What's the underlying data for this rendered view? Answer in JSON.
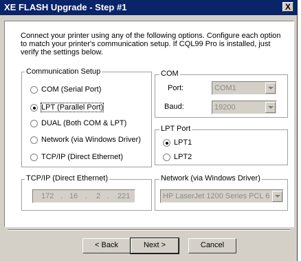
{
  "window": {
    "title": "XE FLASH Upgrade - Step #1",
    "close_glyph": "X"
  },
  "instructions": "Connect your printer using any of the following options.   Configure each option to match your printer's communication setup.  If CQL99 Pro is installed, just verify the settings below.",
  "communication_setup": {
    "label": "Communication Setup",
    "options": [
      {
        "label": "COM (Serial Port)",
        "selected": false
      },
      {
        "label": "LPT (Parallel Port)",
        "selected": true
      },
      {
        "label": "DUAL (Both COM & LPT)",
        "selected": false
      },
      {
        "label": "Network (via Windows Driver)",
        "selected": false
      },
      {
        "label": "TCP/IP (Direct Ethernet)",
        "selected": false
      }
    ]
  },
  "com": {
    "label": "COM",
    "port_label": "Port:",
    "port_value": "COM1",
    "baud_label": "Baud:",
    "baud_value": "19200"
  },
  "lpt_port": {
    "label": "LPT Port",
    "options": [
      {
        "label": "LPT1",
        "selected": true
      },
      {
        "label": "LPT2",
        "selected": false
      }
    ]
  },
  "tcpip": {
    "label": "TCP/IP (Direct Ethernet)",
    "ip": [
      "172",
      "16",
      "2",
      "221"
    ]
  },
  "network": {
    "label": "Network (via Windows Driver)",
    "printer": "HP LaserJet 1200 Series PCL 6"
  },
  "buttons": {
    "back": "< Back",
    "next": "Next >",
    "cancel": "Cancel"
  },
  "colors": {
    "titlebar": "#0a246a",
    "face": "#d4d0c8",
    "panel": "#ffffff"
  }
}
